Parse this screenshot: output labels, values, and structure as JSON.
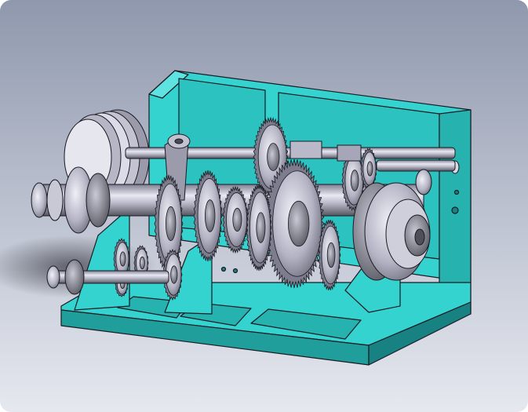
{
  "scene": {
    "subject": "gearbox-assembly-3d-render",
    "colors": {
      "background_top": "#9aa3b7",
      "background_bottom": "#d7dbe6",
      "housing": "#35d3cf",
      "housing_dark": "#1f9e9b",
      "housing_shadow": "#178281",
      "metal_light": "#e3e3ee",
      "metal_mid": "#a9a9bb",
      "metal_dark": "#5e5e6e",
      "gear_teeth": "#7d7d8e",
      "outline": "#1a1a22"
    },
    "icons": {
      "bearing": "ring",
      "gear": "toothed-disc",
      "shaft": "cylinder",
      "pulley": "grooved-disc"
    }
  }
}
